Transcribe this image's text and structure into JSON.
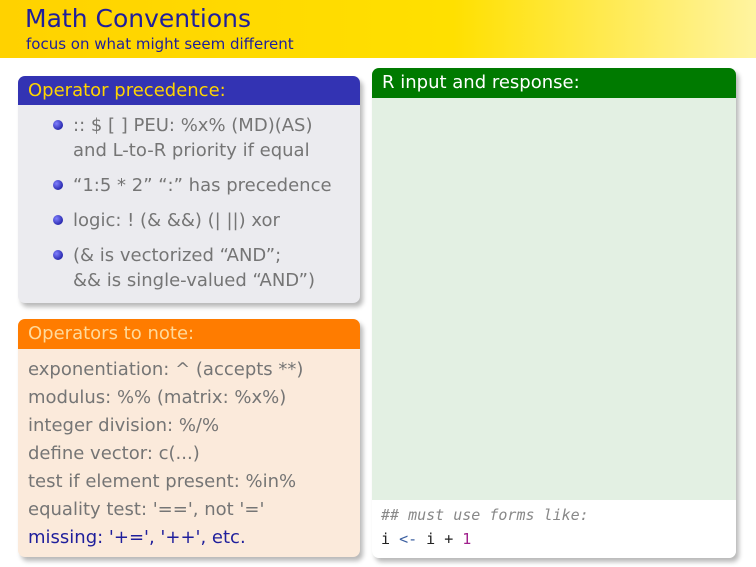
{
  "header": {
    "title": "Math Conventions",
    "subtitle": "focus on what might seem different"
  },
  "precedence": {
    "heading": "Operator precedence:",
    "items": [
      {
        "line1": ":: $ [ ] PEU: %x% (MD)(AS)",
        "line2": "and L-to-R priority if equal"
      },
      {
        "line1": "“1:5 * 2” “:” has precedence",
        "line2": ""
      },
      {
        "line1": "logic: ! (& &&) (| ||) xor",
        "line2": ""
      },
      {
        "line1": "(& is vectorized “AND”;",
        "line2": "&& is single-valued “AND”)"
      }
    ]
  },
  "operators_note": {
    "heading": "Operators to note:",
    "lines": [
      "exponentiation: ^ (accepts **)",
      "modulus: %% (matrix: %x%)",
      "integer division: %/%",
      "define vector: c(...)",
      "test if element present: %in%",
      "equality test: '==', not '='",
      "missing: '+=', '++', etc."
    ]
  },
  "r_panel": {
    "heading": "R input and response:",
    "comment": "## must use forms like:",
    "code": {
      "var": "i",
      "assign": "<-",
      "expr": "i +",
      "number": "1"
    }
  },
  "colors": {
    "header_bg": "#ffd200",
    "title_text": "#1f1f9c",
    "precedence_header": "#3333b3",
    "precedence_header_text": "#ffd400",
    "note_header": "#ff7c00",
    "r_header": "#007a00",
    "r_body": "#e3f0e3"
  }
}
